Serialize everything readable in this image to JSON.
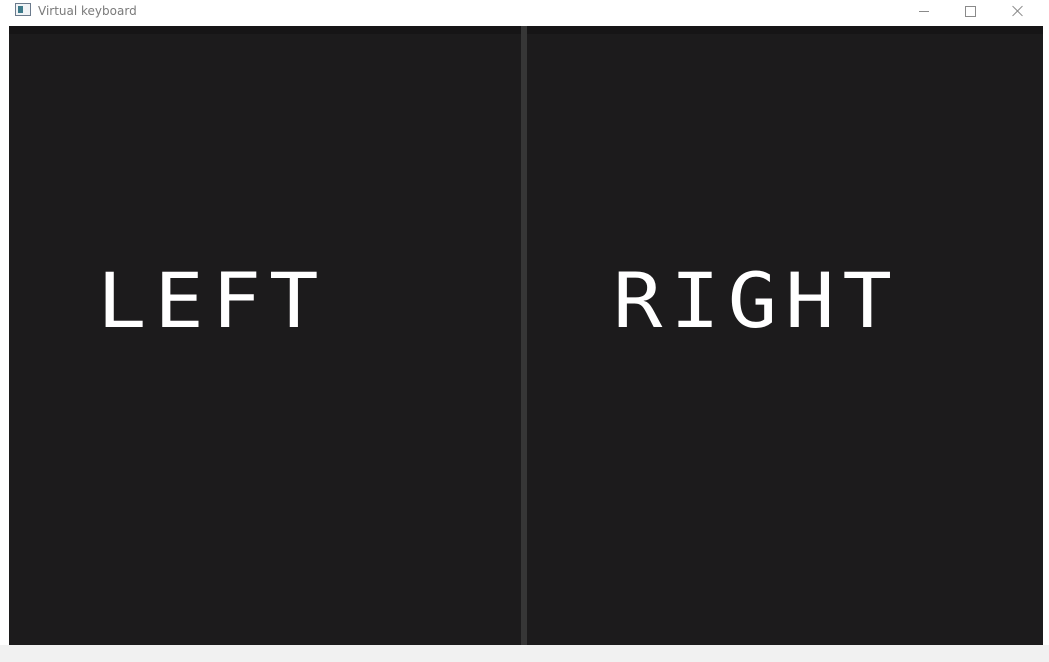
{
  "window": {
    "title": "Virtual keyboard",
    "controls": {
      "minimize_icon": "minimize-icon",
      "maximize_icon": "maximize-icon",
      "close_icon": "close-icon"
    }
  },
  "canvas": {
    "background": "#1c1b1c",
    "divider_color": "#363636",
    "text_color": "#ffffff",
    "panels": [
      {
        "id": "left",
        "label": "LEFT"
      },
      {
        "id": "right",
        "label": "RIGHT"
      }
    ]
  }
}
